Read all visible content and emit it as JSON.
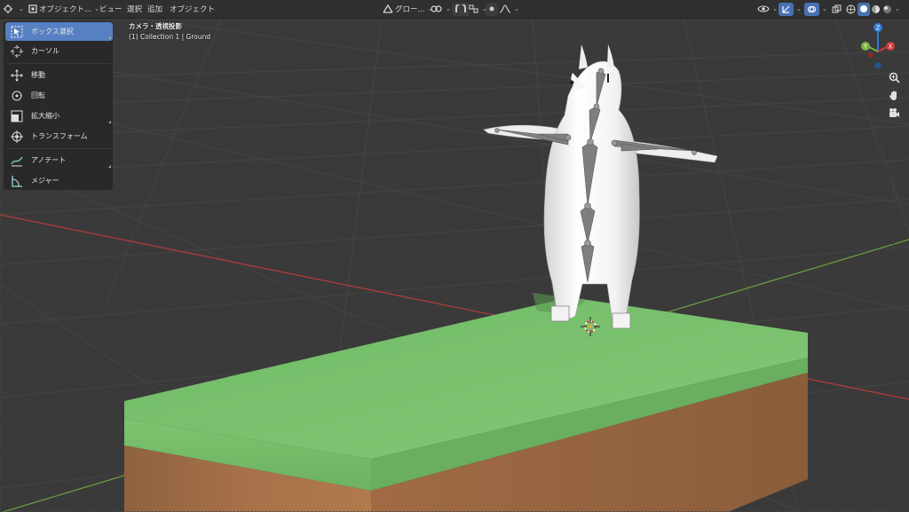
{
  "header": {
    "mode_label": "オブジェクト...",
    "menus": [
      "ビュー",
      "選択",
      "追加",
      "オブジェクト"
    ],
    "orientation_label": "グロー..."
  },
  "toolbar": {
    "tools": [
      {
        "label": "ボックス選択",
        "icon": "box-select-icon",
        "active": true
      },
      {
        "label": "カーソル",
        "icon": "cursor-icon"
      },
      {
        "label": "移動",
        "icon": "move-icon"
      },
      {
        "label": "回転",
        "icon": "rotate-icon"
      },
      {
        "label": "拡大縮小",
        "icon": "scale-icon"
      },
      {
        "label": "トランスフォーム",
        "icon": "transform-icon"
      },
      {
        "label": "アノテート",
        "icon": "annotate-icon"
      },
      {
        "label": "メジャー",
        "icon": "measure-icon"
      }
    ]
  },
  "viewport": {
    "view_name": "カメラ・透視投影",
    "collection_info": "(1) Collection 1 | Ground"
  },
  "gizmo": {
    "z_label": "Z",
    "y_label": "Y",
    "x_label": "X"
  },
  "colors": {
    "active_tool": "#5680c2",
    "grass": "#76c06a",
    "dirt": "#9a6a43",
    "x_axis": "#d43a3a",
    "y_axis": "#7ab241",
    "z_axis": "#2f7bd8"
  }
}
